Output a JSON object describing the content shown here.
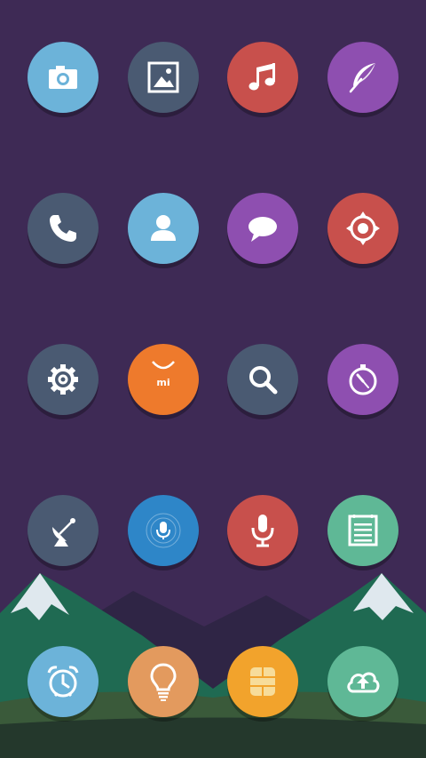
{
  "screen": {
    "type": "home-screen",
    "background_color": "#3e2a55"
  },
  "icon_grid": [
    {
      "icon": "camera-icon",
      "color": "#6cb3d9"
    },
    {
      "icon": "gallery-icon",
      "color": "#4a5a72"
    },
    {
      "icon": "music-icon",
      "color": "#c8504c"
    },
    {
      "icon": "feather-icon",
      "color": "#8e4fb0"
    },
    {
      "icon": "phone-icon",
      "color": "#4a5a72"
    },
    {
      "icon": "contacts-icon",
      "color": "#6cb3d9"
    },
    {
      "icon": "messages-icon",
      "color": "#8e4fb0"
    },
    {
      "icon": "target-icon",
      "color": "#c8504c"
    },
    {
      "icon": "settings-icon",
      "color": "#4a5a72"
    },
    {
      "icon": "mi-store-icon",
      "color": "#ee7a2c",
      "label": "mi"
    },
    {
      "icon": "search-icon",
      "color": "#4a5a72"
    },
    {
      "icon": "compass-icon",
      "color": "#8e4fb0"
    },
    {
      "icon": "satellite-icon",
      "color": "#4a5a72"
    },
    {
      "icon": "voice-assistant-icon",
      "color": "#2e86c8"
    },
    {
      "icon": "microphone-icon",
      "color": "#c8504c"
    },
    {
      "icon": "notes-icon",
      "color": "#5fb896"
    }
  ],
  "dock": [
    {
      "icon": "alarm-clock-icon",
      "color": "#6cb3d9"
    },
    {
      "icon": "lightbulb-icon",
      "color": "#e39a5e"
    },
    {
      "icon": "sim-card-icon",
      "color": "#f2a32c"
    },
    {
      "icon": "cloud-upload-icon",
      "color": "#5fb896"
    }
  ]
}
